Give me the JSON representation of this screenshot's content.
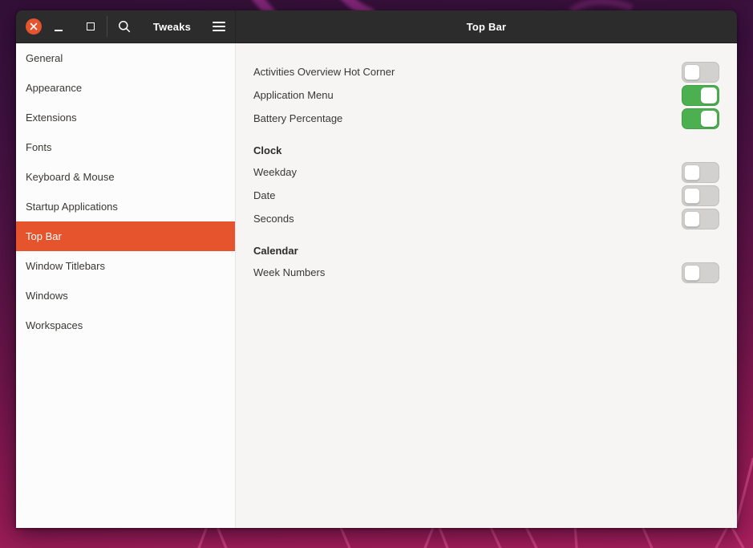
{
  "colors": {
    "accent_orange": "#E6542E",
    "toggle_on_green": "#4CAF50",
    "header_bg": "#2c2c2c",
    "sidebar_bg": "#fcfcfc",
    "content_bg": "#f6f5f4"
  },
  "window": {
    "header": {
      "app_title": "Tweaks",
      "page_title": "Top Bar",
      "icons": [
        "close-icon",
        "minimize-icon",
        "maximize-icon",
        "search-icon",
        "hamburger-menu-icon"
      ]
    },
    "sidebar": {
      "items": [
        {
          "label": "General",
          "selected": false
        },
        {
          "label": "Appearance",
          "selected": false
        },
        {
          "label": "Extensions",
          "selected": false
        },
        {
          "label": "Fonts",
          "selected": false
        },
        {
          "label": "Keyboard & Mouse",
          "selected": false
        },
        {
          "label": "Startup Applications",
          "selected": false
        },
        {
          "label": "Top Bar",
          "selected": true
        },
        {
          "label": "Window Titlebars",
          "selected": false
        },
        {
          "label": "Windows",
          "selected": false
        },
        {
          "label": "Workspaces",
          "selected": false
        }
      ]
    },
    "content": {
      "sections": [
        {
          "header": "",
          "rows": [
            {
              "label": "Activities Overview Hot Corner",
              "enabled": false
            },
            {
              "label": "Application Menu",
              "enabled": true
            },
            {
              "label": "Battery Percentage",
              "enabled": true
            }
          ]
        },
        {
          "header": "Clock",
          "rows": [
            {
              "label": "Weekday",
              "enabled": false
            },
            {
              "label": "Date",
              "enabled": false
            },
            {
              "label": "Seconds",
              "enabled": false
            }
          ]
        },
        {
          "header": "Calendar",
          "rows": [
            {
              "label": "Week Numbers",
              "enabled": false
            }
          ]
        }
      ]
    }
  }
}
